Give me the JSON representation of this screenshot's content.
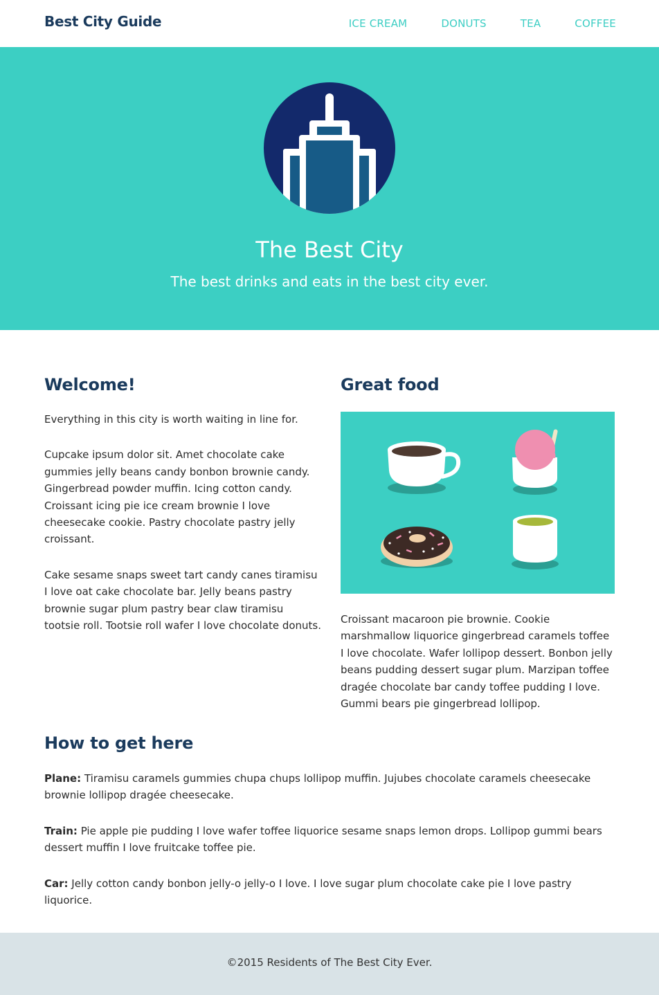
{
  "header": {
    "brand": "Best City Guide",
    "nav": [
      "ICE CREAM",
      "DONUTS",
      "TEA",
      "COFFEE"
    ]
  },
  "hero": {
    "logo_icon": "skyscraper-icon",
    "title": "The Best City",
    "subtitle": "The best drinks and eats in the best city ever."
  },
  "welcome": {
    "heading": "Welcome!",
    "paragraphs": [
      "Everything in this city is worth waiting in line for.",
      "Cupcake ipsum dolor sit. Amet chocolate cake gummies jelly beans candy bonbon brownie candy. Gingerbread powder muffin. Icing cotton candy. Croissant icing pie ice cream brownie I love cheesecake cookie. Pastry chocolate pastry jelly croissant.",
      "Cake sesame snaps sweet tart candy canes tiramisu I love oat cake chocolate bar. Jelly beans pastry brownie sugar plum pastry bear claw tiramisu tootsie roll. Tootsie roll wafer I love chocolate donuts."
    ]
  },
  "food": {
    "heading": "Great food",
    "image_icons": [
      "coffee-cup-icon",
      "ice-cream-icon",
      "donut-icon",
      "tea-cup-icon"
    ],
    "paragraph": "Croissant macaroon pie brownie. Cookie marshmallow liquorice gingerbread caramels toffee I love chocolate. Wafer lollipop dessert. Bonbon jelly beans pudding dessert sugar plum. Marzipan toffee dragée chocolate bar candy toffee pudding I love. Gummi bears pie gingerbread lollipop."
  },
  "directions": {
    "heading": "How to get here",
    "items": [
      {
        "label": "Plane:",
        "text": " Tiramisu caramels gummies chupa chups lollipop muffin. Jujubes chocolate caramels cheesecake brownie lollipop dragée cheesecake."
      },
      {
        "label": "Train:",
        "text": " Pie apple pie pudding I love wafer toffee liquorice sesame snaps lemon drops. Lollipop gummi bears dessert muffin I love fruitcake toffee pie."
      },
      {
        "label": "Car:",
        "text": " Jelly cotton candy bonbon jelly-o jelly-o I love. I love sugar plum chocolate cake pie I love pastry liquorice."
      }
    ]
  },
  "footer": {
    "text": "©2015 Residents of The Best City Ever."
  },
  "colors": {
    "accent": "#3ccfc3",
    "heading": "#1a3a5c",
    "footer_bg": "#d9e3e7"
  }
}
